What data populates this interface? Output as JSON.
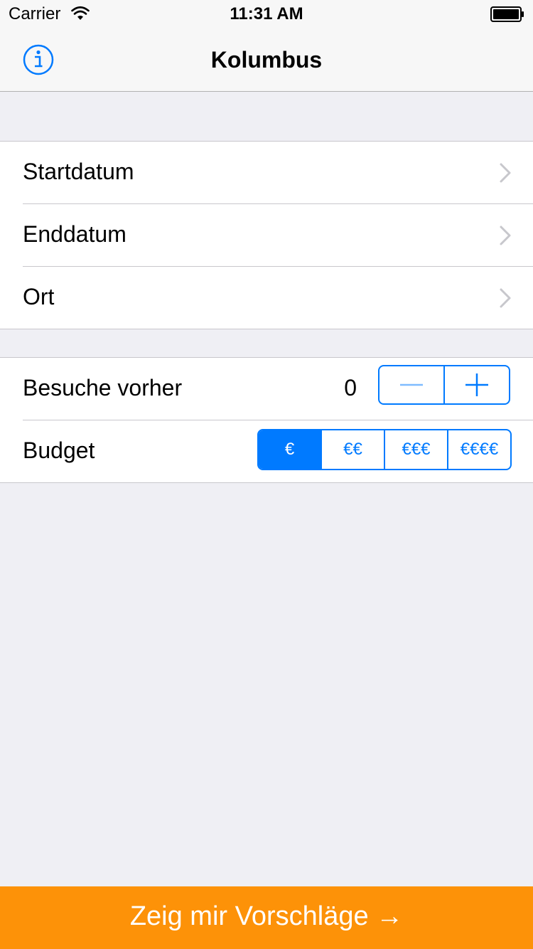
{
  "status_bar": {
    "carrier": "Carrier",
    "time": "11:31 AM",
    "wifi_icon": "wifi-icon",
    "battery_icon": "battery-full-icon"
  },
  "nav": {
    "title": "Kolumbus",
    "info_icon": "info-icon"
  },
  "date_section": {
    "rows": [
      {
        "label": "Startdatum",
        "icon": "chevron-right-icon"
      },
      {
        "label": "Enddatum",
        "icon": "chevron-right-icon"
      },
      {
        "label": "Ort",
        "icon": "chevron-right-icon"
      }
    ]
  },
  "options_section": {
    "visits": {
      "label": "Besuche vorher",
      "value": "0",
      "decrement_icon": "minus-icon",
      "increment_icon": "plus-icon"
    },
    "budget": {
      "label": "Budget",
      "options": [
        "€",
        "€€",
        "€€€",
        "€€€€"
      ],
      "selected": "€"
    }
  },
  "cta": {
    "label": "Zeig mir Vorschläge →"
  },
  "colors": {
    "accent": "#007aff",
    "cta": "#fd9208",
    "background": "#efeff4"
  }
}
